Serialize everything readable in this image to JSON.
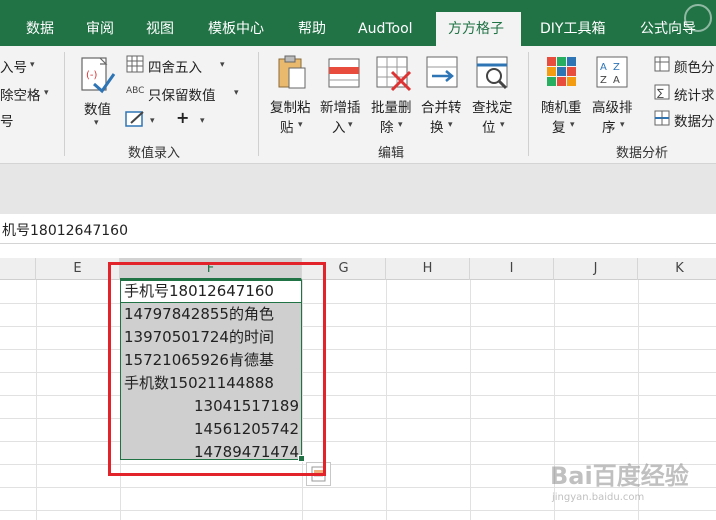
{
  "tabs": [
    "数据",
    "审阅",
    "视图",
    "模板中心",
    "帮助",
    "AudTool",
    "方方格子",
    "DIY工具箱",
    "公式向导"
  ],
  "active_tab_index": 6,
  "ribbon": {
    "left_partial": [
      "入号",
      "除空格",
      "号"
    ],
    "numeric": {
      "value_label": "数值",
      "round_label": "四舍五入",
      "keep_value_label": "只保留数值",
      "plus_label": "+",
      "group_label": "数值录入"
    },
    "edit": {
      "copy_paste": [
        "复制粘",
        "贴"
      ],
      "insert": [
        "新增插",
        "入"
      ],
      "batch_delete": [
        "批量删",
        "除"
      ],
      "merge_convert": [
        "合并转",
        "换"
      ],
      "find_locate": [
        "查找定",
        "位"
      ],
      "group_label": "编辑"
    },
    "analysis": {
      "random_repeat": [
        "随机重",
        "复"
      ],
      "advanced_sort": [
        "高级排",
        "序"
      ],
      "color_split": "颜色分",
      "stat_summary": "统计求",
      "data_split": "数据分",
      "group_label": "数据分析"
    }
  },
  "formula_bar": {
    "content": "机号18012647160"
  },
  "columns": [
    "E",
    "F",
    "G",
    "H",
    "I",
    "J",
    "K"
  ],
  "selected_column": "F",
  "cells": [
    {
      "text": "手机号18012647160",
      "align": "left"
    },
    {
      "text": "14797842855的角色",
      "align": "left"
    },
    {
      "text": "13970501724的时间",
      "align": "left"
    },
    {
      "text": "15721065926肯德基",
      "align": "left"
    },
    {
      "text": "手机数15021144888",
      "align": "left"
    },
    {
      "text": "13041517189",
      "align": "right"
    },
    {
      "text": "14561205742",
      "align": "right"
    },
    {
      "text": "14789471474",
      "align": "right"
    }
  ],
  "watermark": {
    "brand": "Bai百度经验",
    "url": "jingyan.baidu.com"
  },
  "colors": {
    "excel_green": "#217346",
    "highlight_red": "#e2232a",
    "selection_gray": "#cfcfcf"
  }
}
